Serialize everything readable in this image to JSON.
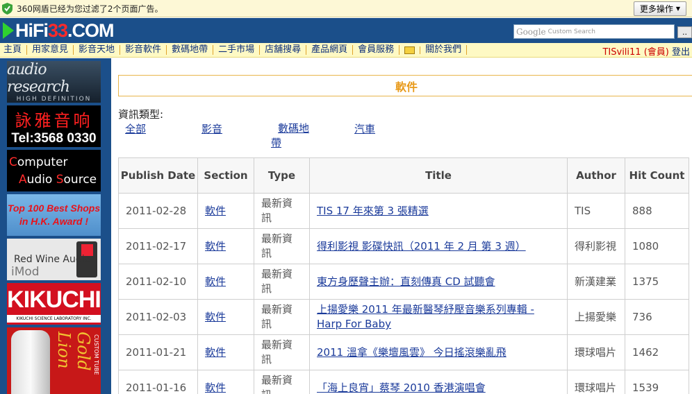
{
  "notify": {
    "message": "360网盾已经为您过滤了2个页面广告。",
    "more_button": "更多操作",
    "dropdown_icon": "▼"
  },
  "header": {
    "logo": {
      "part1": "HiFi",
      "part2": "33",
      "part3": ".COM"
    },
    "search": {
      "brand": "Google",
      "placeholder": "Custom Search"
    },
    "search_button": "..",
    "colors": {
      "background": "#1b4f8a",
      "logo_accent": "#ff2a2a",
      "logo_arrow": "#2fd12f"
    }
  },
  "nav": {
    "items": [
      "主頁",
      "用家意見",
      "影音天地",
      "影音軟件",
      "數碼地帶",
      "二手市場",
      "店舖搜尋",
      "產品網頁",
      "會員服務",
      "",
      "關於我們"
    ],
    "mail_icon": "mail-icon",
    "user": {
      "name": "TISvili11 (會員)",
      "logout": "登出"
    }
  },
  "sidebar": {
    "ads": [
      {
        "line1": "audio research",
        "line2": "HIGH DEFINITION"
      },
      {
        "line1": "詠雅音响",
        "line2": "Tel:3568 0330"
      },
      {
        "line1": {
          "c": "C",
          "rest": "omputer"
        },
        "line2": {
          "a": "A",
          "rest1": "udio ",
          "s": "S",
          "rest2": "ource"
        }
      },
      {
        "line1": "Top 100 Best Shops",
        "line2": "in H.K. Award !"
      },
      {
        "line1": "Red Wine Audio",
        "line2": "iMod"
      },
      {
        "line1": "KIKUCHI",
        "line2": "KIKUCHI SCIENCE LABORATORY INC."
      },
      {
        "line1": "Gold Lion",
        "line2": "CUSTOM TUBE"
      }
    ]
  },
  "main": {
    "title": "軟件",
    "category_label": "資訊類型:",
    "categories": [
      "全部",
      "影音",
      "數碼地帶",
      "汽車"
    ],
    "table": {
      "headers": [
        "Publish Date",
        "Section",
        "Type",
        "Title",
        "Author",
        "Hit Count"
      ],
      "rows": [
        {
          "date": "2011-02-28",
          "section": "軟件",
          "type": "最新資訊",
          "title": "TIS 17 年來第 3 張精選",
          "author": "TIS",
          "hits": "888"
        },
        {
          "date": "2011-02-17",
          "section": "軟件",
          "type": "最新資訊",
          "title": "得利影視 影碟快訊（2011 年 2 月 第 3 週）",
          "author": "得利影視",
          "hits": "1080"
        },
        {
          "date": "2011-02-10",
          "section": "軟件",
          "type": "最新資訊",
          "title": "東方身歷聲主辦：直刻傳真 CD 試聽會",
          "author": "新漢建業",
          "hits": "1375"
        },
        {
          "date": "2011-02-03",
          "section": "軟件",
          "type": "最新資訊",
          "title": "上揚愛樂 2011 年最新醫琴紓壓音樂系列專輯 - Harp For Baby",
          "author": "上揚愛樂",
          "hits": "736"
        },
        {
          "date": "2011-01-21",
          "section": "軟件",
          "type": "最新資訊",
          "title": "2011 溫拿《樂壇風雲》 今日搖滾樂亂飛",
          "author": "環球唱片",
          "hits": "1462"
        },
        {
          "date": "2011-01-16",
          "section": "軟件",
          "type": "最新資訊",
          "title": "「海上良宵」蔡琴 2010 香港演唱會",
          "author": "環球唱片",
          "hits": "1539"
        }
      ]
    }
  }
}
